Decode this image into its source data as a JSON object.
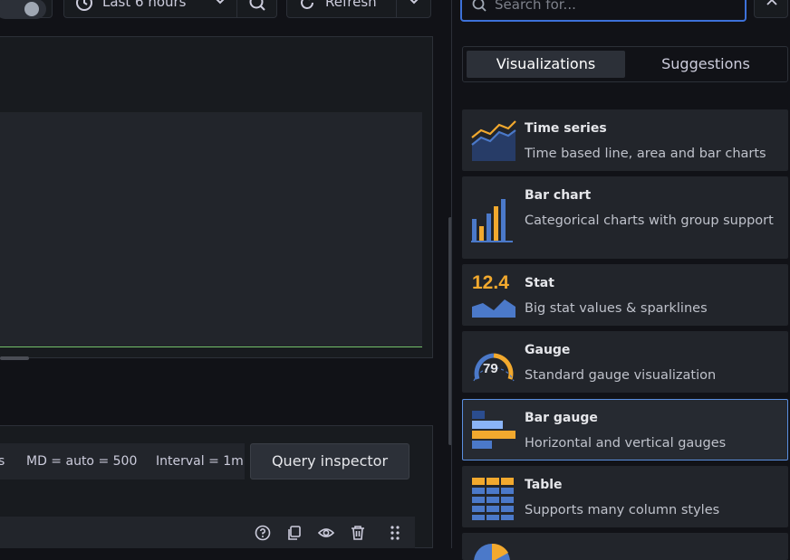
{
  "toolbar": {
    "time_range_label": "Last 6 hours",
    "refresh_label": "Refresh"
  },
  "query": {
    "md_text": "MD = auto = 500",
    "interval_text": "Interval = 1m",
    "inspector_label": "Query inspector",
    "cut_text": "s"
  },
  "viz_picker": {
    "search_placeholder": "Search for...",
    "tabs": {
      "visualizations": "Visualizations",
      "suggestions": "Suggestions"
    },
    "items": [
      {
        "title": "Time series",
        "desc": "Time based line, area and bar charts",
        "icon": "time-series-icon"
      },
      {
        "title": "Bar chart",
        "desc": "Categorical charts with group support",
        "icon": "bar-chart-icon"
      },
      {
        "title": "Stat",
        "desc": "Big stat values & sparklines",
        "icon": "stat-icon",
        "icon_text": "12.4"
      },
      {
        "title": "Gauge",
        "desc": "Standard gauge visualization",
        "icon": "gauge-icon",
        "icon_text": "79"
      },
      {
        "title": "Bar gauge",
        "desc": "Horizontal and vertical gauges",
        "icon": "bar-gauge-icon",
        "selected": true
      },
      {
        "title": "Table",
        "desc": "Supports many column styles",
        "icon": "table-icon"
      }
    ]
  },
  "colors": {
    "accent_blue": "#3d71d9",
    "viz_yellow": "#f2a92e",
    "viz_blue": "#4b79c9",
    "threshold_green": "#73bf69"
  }
}
